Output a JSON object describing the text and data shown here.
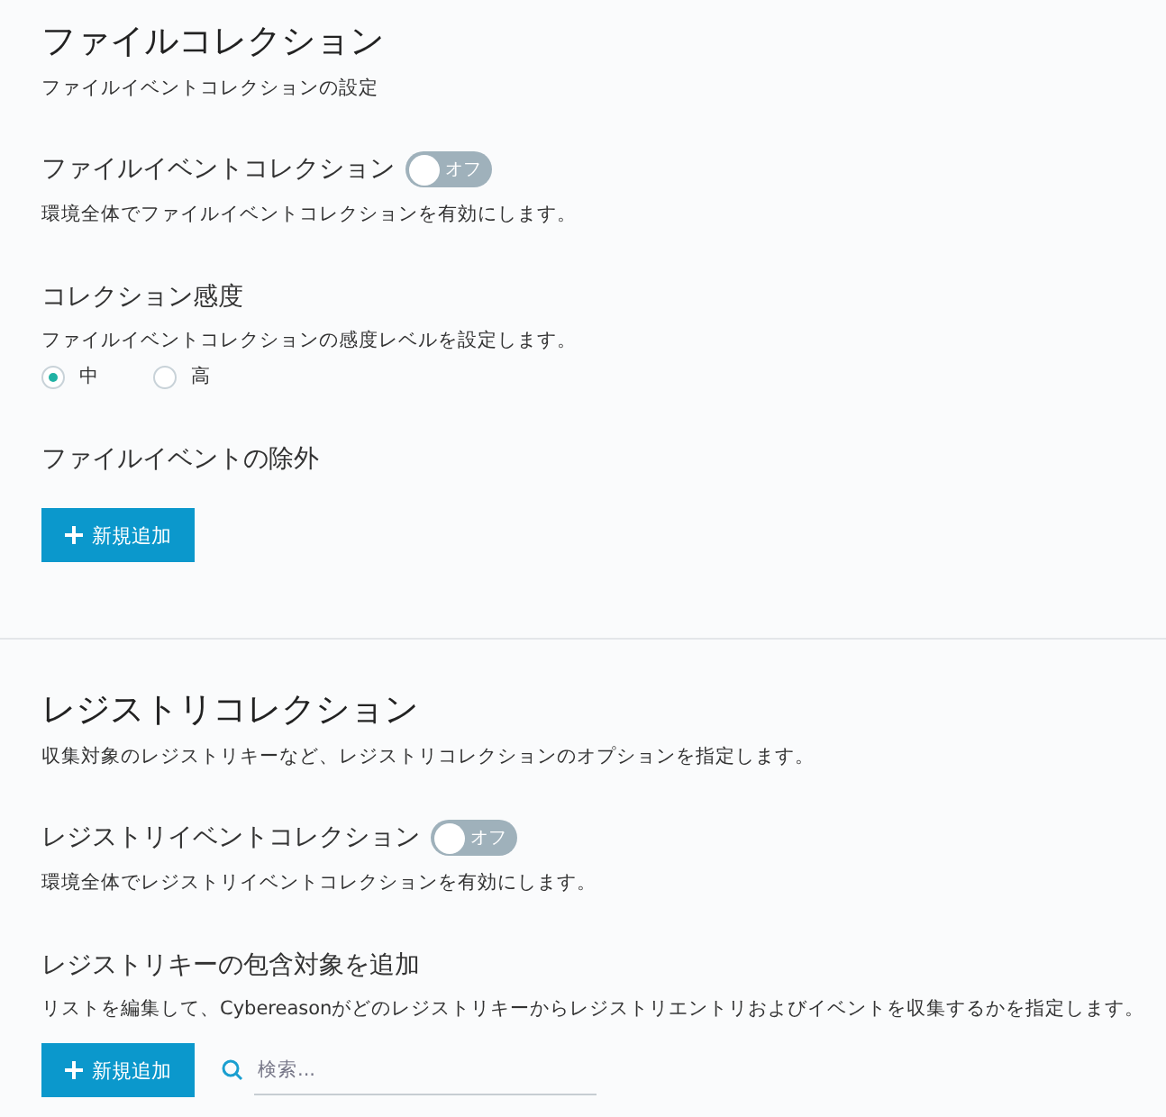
{
  "sections": [
    {
      "title": "ファイルコレクション",
      "subtitle": "ファイルイベントコレクションの設定",
      "settings": [
        {
          "kind": "toggle",
          "label": "ファイルイベントコレクション",
          "toggle_label": "オフ",
          "on": false,
          "description": "環境全体でファイルイベントコレクションを有効にします。"
        },
        {
          "kind": "radio",
          "label": "コレクション感度",
          "description": "ファイルイベントコレクションの感度レベルを設定します。",
          "options": [
            {
              "label": "中",
              "selected": true
            },
            {
              "label": "高",
              "selected": false
            }
          ]
        },
        {
          "kind": "add",
          "label": "ファイルイベントの除外",
          "button": "新規追加"
        }
      ]
    },
    {
      "title": "レジストリコレクション",
      "subtitle": "収集対象のレジストリキーなど、レジストリコレクションのオプションを指定します。",
      "settings": [
        {
          "kind": "toggle",
          "label": "レジストリイベントコレクション",
          "toggle_label": "オフ",
          "on": false,
          "description": "環境全体でレジストリイベントコレクションを有効にします。"
        },
        {
          "kind": "add",
          "label": "レジストリキーの包含対象を追加",
          "description": "リストを編集して、Cybereasonがどのレジストリキーからレジストリエントリおよびイベントを収集するかを指定します。",
          "button": "新規追加",
          "search_placeholder": "検索..."
        }
      ]
    }
  ]
}
